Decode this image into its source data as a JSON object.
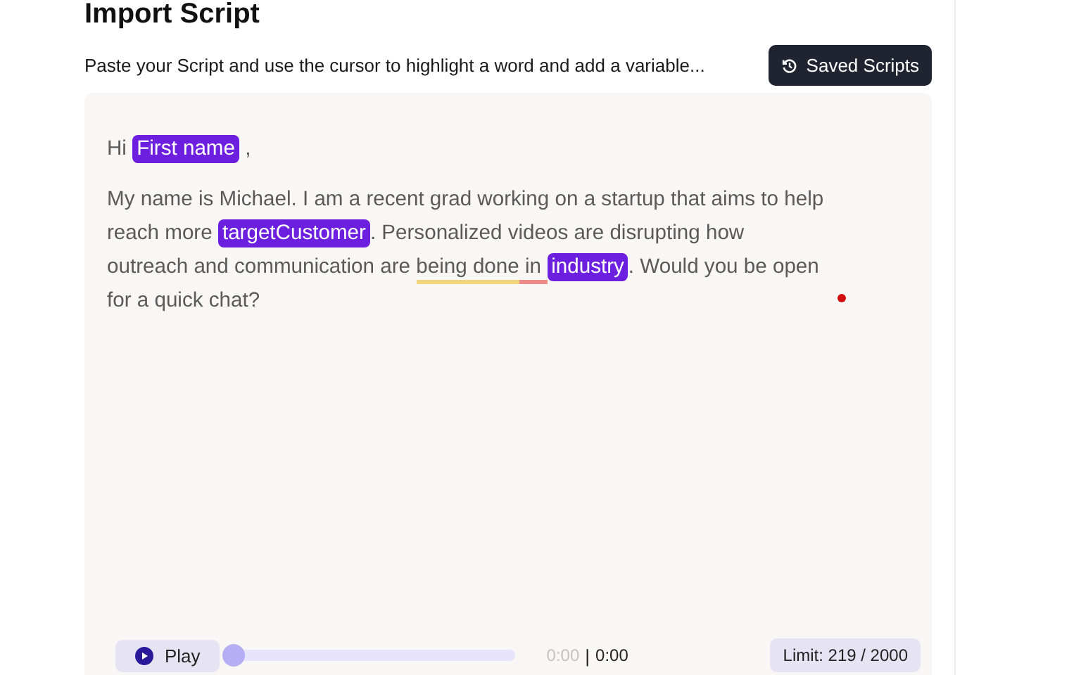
{
  "title": "Import Script",
  "instructions": "Paste your Script and use the cursor to highlight a word and add a variable...",
  "saved_button": "Saved Scripts",
  "script": {
    "paragraphs": [
      [
        {
          "kind": "text",
          "text": "Hi "
        },
        {
          "kind": "variable",
          "text": "First name"
        },
        {
          "kind": "text",
          "text": " ,"
        }
      ],
      [
        {
          "kind": "text",
          "text": "My name is Michael. I am a recent grad working on a startup that aims to help reach more "
        },
        {
          "kind": "variable",
          "text": "targetCustomer"
        },
        {
          "kind": "text",
          "text": ". Personalized videos are disrupting how outreach and communication are "
        },
        {
          "kind": "underlined",
          "text": "being done",
          "color": "#f2d57a"
        },
        {
          "kind": "underlined",
          "text": " in ",
          "color": "#f08a8a"
        },
        {
          "kind": "variable",
          "text": "industry"
        },
        {
          "kind": "text",
          "text": ". Would you be open for a quick chat?"
        }
      ]
    ]
  },
  "player": {
    "button": "Play",
    "level": 0.0,
    "elapsed": "0:00",
    "separator": "|",
    "duration": "0:00"
  },
  "limit": "Limit: 219 / 2000"
}
